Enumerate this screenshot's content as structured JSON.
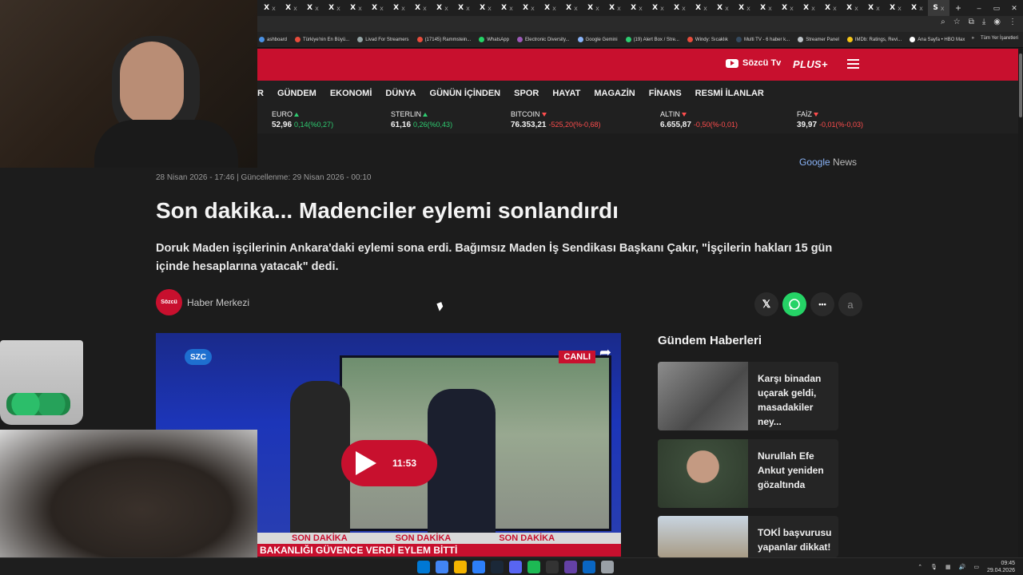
{
  "browser": {
    "tabs_count": 31,
    "tab_glyph": "X",
    "tab_close": "x",
    "active_tab_glyph": "S",
    "new_tab": "+",
    "window_controls": [
      "–",
      "▭",
      "✕"
    ],
    "bookmarks": [
      {
        "label": "ashboard",
        "color": "#4a90e2"
      },
      {
        "label": "Türkiye'nin En Büyü...",
        "color": "#e74c3c"
      },
      {
        "label": "Livad For Streamers",
        "color": "#95a5a6"
      },
      {
        "label": "(17145) Rammstein...",
        "color": "#e74c3c"
      },
      {
        "label": "WhatsApp",
        "color": "#25d366"
      },
      {
        "label": "Electronic Diversity...",
        "color": "#9b59b6"
      },
      {
        "label": "Google Gemini",
        "color": "#8ab4f8"
      },
      {
        "label": "(19) Alert Box / Stre...",
        "color": "#2ecc71"
      },
      {
        "label": "Windy: Sıcaklık",
        "color": "#e74c3c"
      },
      {
        "label": "Multi TV - 6 haber k...",
        "color": "#34495e"
      },
      {
        "label": "Streamer Panel",
        "color": "#bdc3c7"
      },
      {
        "label": "IMDb: Ratings, Revi...",
        "color": "#f5c518"
      },
      {
        "label": "Ana Sayfa • HBO Max",
        "color": "#ffffff"
      }
    ],
    "bookmarks_more": "»",
    "all_bookmarks": "Tüm Yer İşaretleri"
  },
  "site": {
    "sozcu_tv": "Sözcü Tv",
    "plus": "PLUS+",
    "nav": [
      "R",
      "GÜNDEM",
      "EKONOMİ",
      "DÜNYA",
      "GÜNÜN İÇİNDEN",
      "SPOR",
      "HAYAT",
      "MAGAZİN",
      "FİNANS",
      "RESMİ İLANLAR"
    ],
    "ticker": [
      {
        "name": "EURO",
        "dir": "up",
        "value": "52,96",
        "change": "0,14(%0,27)"
      },
      {
        "name": "STERLIN",
        "dir": "up",
        "value": "61,16",
        "change": "0,26(%0,43)"
      },
      {
        "name": "BITCOIN",
        "dir": "down",
        "value": "76.353,21",
        "change": "-525,20(%-0,68)"
      },
      {
        "name": "ALTIN",
        "dir": "down",
        "value": "6.655,87",
        "change": "-0,50(%-0,01)"
      },
      {
        "name": "FAİZ",
        "dir": "down",
        "value": "39,97",
        "change": "-0,01(%-0,03)"
      }
    ],
    "colors": {
      "brand_red": "#c8102e",
      "up": "#2ecc71",
      "down": "#ff4d4d"
    }
  },
  "article": {
    "google_news_g": "Google",
    "google_news_n": "News",
    "dateline": "28 Nisan 2026 - 17:46   |   Güncellenme: 29 Nisan 2026 - 00:10",
    "headline": "Son dakika... Madenciler eylemi sonlandırdı",
    "summary": "Doruk Maden işçilerinin Ankara'daki eylemi sona erdi. Bağımsız Maden İş Sendikası Başkanı Çakır, \"İşçilerin hakları 15 gün içinde hesaplarına yatacak\" dedi.",
    "author_logo": "Sözcü",
    "author": "Haber Merkezi",
    "share": {
      "x": "𝕏",
      "more": "•••",
      "font": "a"
    },
    "video": {
      "live_badge": "CANLI",
      "channel": "SZC",
      "duration": "11:53",
      "band_items": [
        "SON DAKİKA",
        "SON DAKİKA",
        "SON DAKİKA"
      ],
      "bottom_band": "BAKANLIĞI GÜVENCE VERDİ EYLEM BİTTİ"
    }
  },
  "sidebar": {
    "title": "Gündem Haberleri",
    "items": [
      {
        "text": "Karşı binadan uçarak geldi, masadakiler ney..."
      },
      {
        "text": "Nurullah Efe Ankut yeniden gözaltında"
      },
      {
        "text": "TOKİ başvurusu yapanlar dikkat!"
      }
    ]
  },
  "taskbar": {
    "apps": [
      "#0078d4",
      "#4285f4",
      "#f4b400",
      "#2d7ff9",
      "#1b2838",
      "#5865f2",
      "#1db954",
      "#333333",
      "#6441a5",
      "#0a66c2",
      "#9aa0a6"
    ],
    "time": "09:45",
    "date": "29.04.2026"
  }
}
